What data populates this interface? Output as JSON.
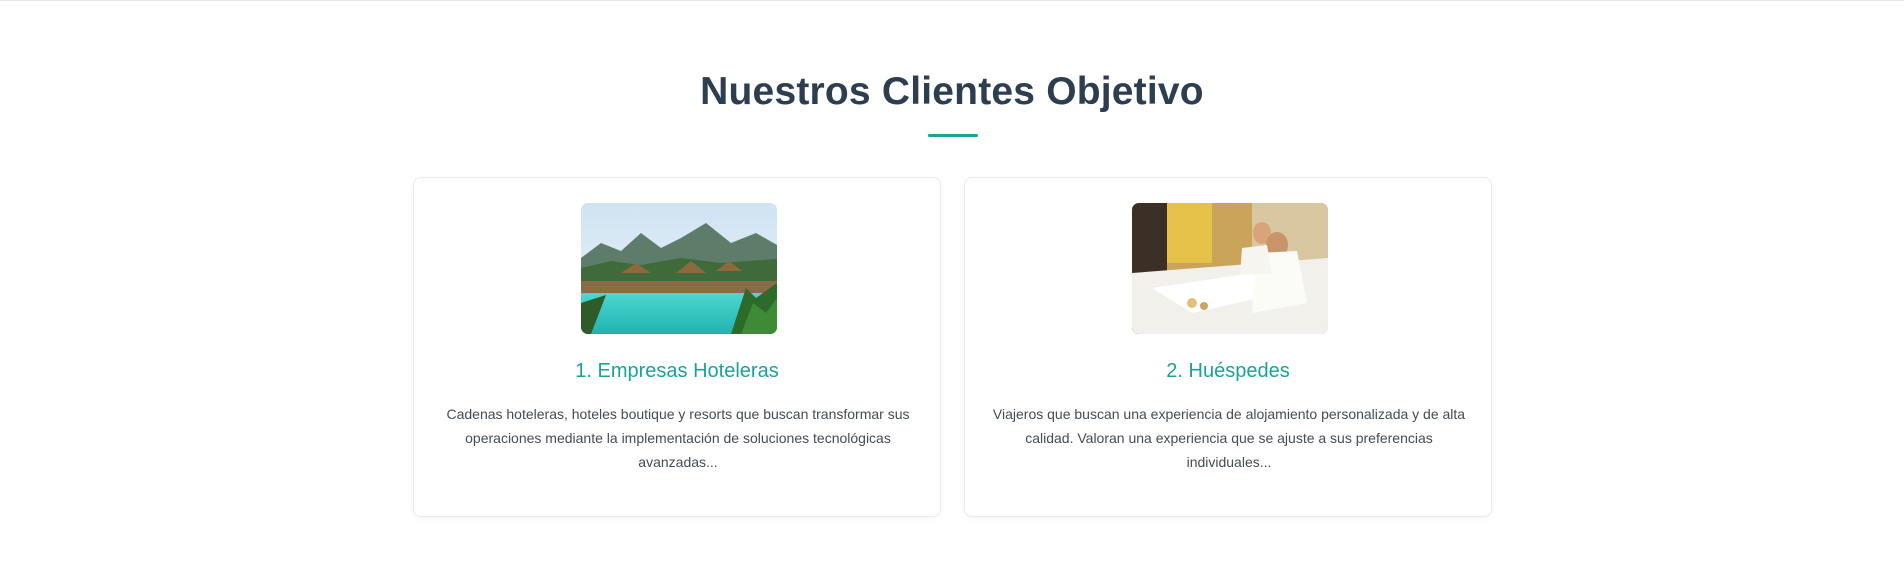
{
  "section": {
    "title": "Nuestros Clientes Objetivo",
    "accent_color": "#1aa39a",
    "title_color": "#2c3e50"
  },
  "cards": [
    {
      "image_name": "resort-pool-image",
      "title": "1. Empresas Hoteleras",
      "description": "Cadenas hoteleras, hoteles boutique y resorts que buscan transformar sus operaciones mediante la implementación de soluciones tecnológicas avanzadas..."
    },
    {
      "image_name": "hotel-guests-image",
      "title": "2. Huéspedes",
      "description": "Viajeros que buscan una experiencia de alojamiento personalizada y de alta calidad. Valoran una experiencia que se ajuste a sus preferencias individuales..."
    }
  ]
}
